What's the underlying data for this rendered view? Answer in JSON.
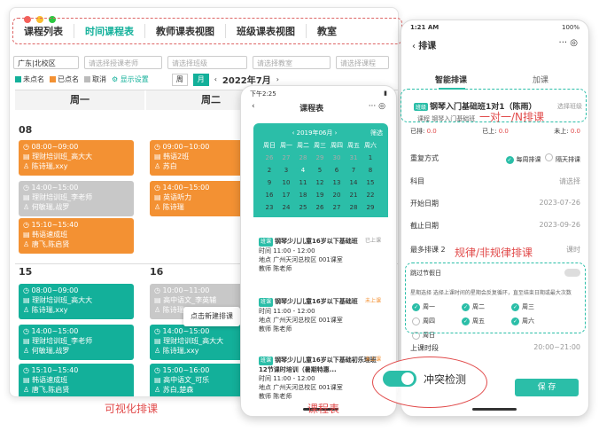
{
  "main": {
    "tabs": [
      "课程列表",
      "时间课程表",
      "教师课表视图",
      "班级课表视图",
      "教室"
    ],
    "filters": {
      "campus": "广东|北校区",
      "teacher_ph": "请选择授课老师",
      "class_ph": "请选择班级",
      "room_ph": "请选择教室",
      "course_ph": "请选择课程"
    },
    "legend": {
      "unbooked": "未点名",
      "booked": "已点名",
      "cancel": "取消",
      "display": "显示设置"
    },
    "view": {
      "week": "周",
      "month": "月",
      "month_label": "2022年7月"
    },
    "days": [
      "周一",
      "周二"
    ],
    "dates": [
      "08",
      "15",
      "16"
    ],
    "events": [
      {
        "time": "08:00~09:00",
        "title": "理财培训班_高大大",
        "teacher": "陈诗瑞,xxy",
        "color": "o"
      },
      {
        "time": "14:00~15:00",
        "title": "理财培训班_李老师",
        "teacher": "何敏瑞,战罗",
        "color": "g"
      },
      {
        "time": "15:10~15:40",
        "title": "韩语速成班",
        "teacher": "唐飞,陈启贤",
        "color": "o"
      },
      {
        "time": "09:00~10:00",
        "title": "韩语2班",
        "teacher": "苏白",
        "color": "o"
      },
      {
        "time": "14:00~15:00",
        "title": "英语听力",
        "teacher": "陈诗瑞",
        "color": "o"
      },
      {
        "time": "08:00~09:00",
        "title": "理财培训班_高大大",
        "teacher": "陈诗瑞,xxy",
        "color": "t"
      },
      {
        "time": "14:00~15:00",
        "title": "理财培训班_李老师",
        "teacher": "何敏瑞,战罗",
        "color": "t"
      },
      {
        "time": "15:10~15:40",
        "title": "韩语速成班",
        "teacher": "唐飞,陈启贤",
        "color": "t"
      },
      {
        "time": "10:00~11:00",
        "title": "高中语文_李英辅",
        "teacher": "陈诗瑞",
        "color": "g"
      },
      {
        "time": "14:00~15:00",
        "title": "理财培训班_高大大",
        "teacher": "陈诗瑞,xxy",
        "color": "t"
      },
      {
        "time": "15:00~16:00",
        "title": "高中语文_可乐",
        "teacher": "苏白,楚森",
        "color": "t"
      }
    ],
    "tip": "点击新建排课",
    "caption": "可视化排课"
  },
  "phone1": {
    "time": "下午2:25",
    "title": "课程表",
    "month": "2019年06月",
    "filter": "筛选",
    "weekdays": [
      "周日",
      "周一",
      "周二",
      "周三",
      "周四",
      "周五",
      "周六"
    ],
    "weeks": [
      [
        "26",
        "27",
        "28",
        "29",
        "30",
        "31",
        "1"
      ],
      [
        "2",
        "3",
        "4",
        "5",
        "6",
        "7",
        "8"
      ],
      [
        "9",
        "10",
        "11",
        "12",
        "13",
        "14",
        "15"
      ],
      [
        "16",
        "17",
        "18",
        "19",
        "20",
        "21",
        "22"
      ],
      [
        "23",
        "24",
        "25",
        "26",
        "27",
        "28",
        "29"
      ]
    ],
    "cards": [
      {
        "title": "钢琴少儿儿童16岁以下基础班",
        "status": "已上课",
        "time": "时间 11:00 - 12:00",
        "place": "地点 广州天河总校区 001课室",
        "teacher": "教师 陈老师"
      },
      {
        "title": "钢琴少儿儿童16岁以下基础班",
        "status": "未上课",
        "time": "时间 11:00 - 12:00",
        "place": "地点 广州天河总校区 001课室",
        "teacher": "教师 陈老师"
      },
      {
        "title": "钢琴少儿儿童16岁以下基础初乐理班12节课时培训（暑期特惠...",
        "status": "未上课",
        "time": "时间 11:00 - 12:00",
        "place": "地点 广州天河总校区 001课室",
        "teacher": "教师 陈老师"
      }
    ],
    "caption": "课程表"
  },
  "phone2": {
    "time": "1:21 AM",
    "battery": "100%",
    "title": "排课",
    "tab_smart": "智能排课",
    "tab_add": "加课",
    "class_name": "钢琴入门基础班1对1（陈雨）",
    "class_sub": "课程  钢琴入门基础班",
    "choose": "选择班级",
    "stats": [
      {
        "label": "已排:",
        "value": "0.0"
      },
      {
        "label": "已上:",
        "value": "0.0"
      },
      {
        "label": "未上:",
        "value": "0.0"
      }
    ],
    "repeat_label": "重复方式",
    "repeat_opts": [
      "每周排课",
      "隔天排课"
    ],
    "subject_label": "科目",
    "subject_val": "请选择",
    "start_label": "开始日期",
    "start_val": "2023-07-26",
    "end_label": "截止日期",
    "end_val": "2023-09-26",
    "max_label": "最多排课",
    "max_val": "2",
    "max_unit": "课时",
    "skip_label": "跳过节假日",
    "week_hint": "星期选择  选择上课时间的星期会反复循环，直至结束日期或最大次数",
    "weekdays": [
      "周一",
      "周二",
      "周三",
      "周四",
      "周五",
      "周六",
      "周日"
    ],
    "slot_label": "上课时段",
    "slot_val": "20:00~21:00",
    "save": "保 存",
    "label_1n": "一对一/N排课",
    "label_rule": "规律/非规律排课",
    "conflict": "冲突检测"
  }
}
